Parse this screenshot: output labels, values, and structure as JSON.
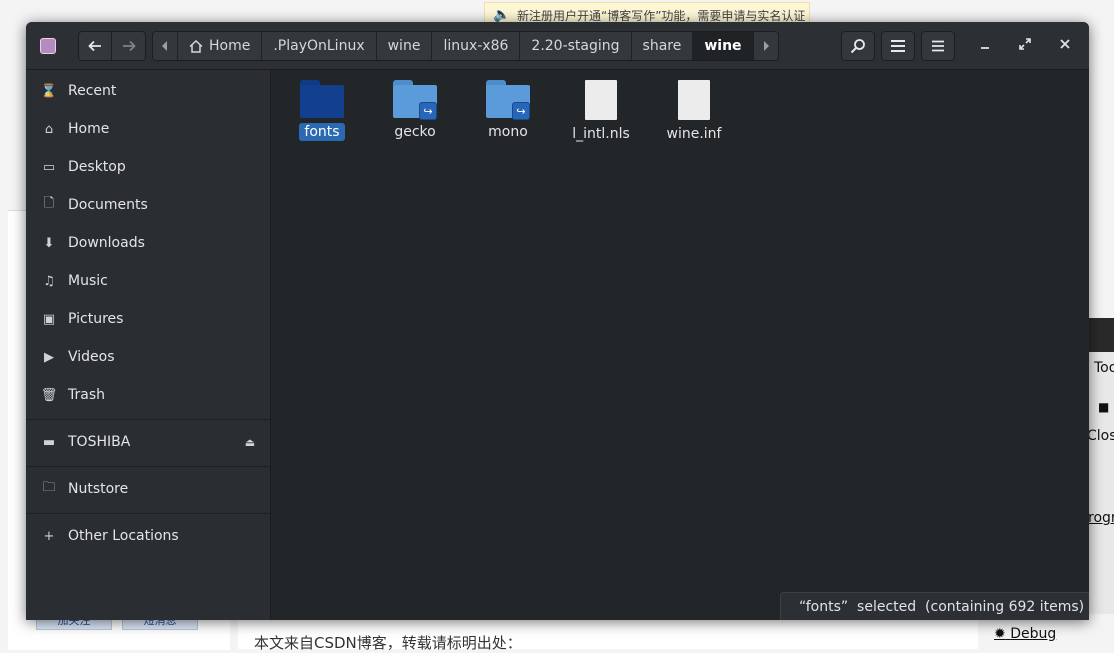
{
  "background": {
    "notice": "新注册用户开通“博客写作”功能，需要申请与实名认证",
    "buttons": [
      "加关注",
      "短消息"
    ],
    "article_text": "本文来自CSDN博客，转载请标明出处：",
    "right_window": {
      "tab": "Too",
      "close": "Clos",
      "link": "rogr",
      "debug": "Debug",
      "close2": "Close"
    }
  },
  "window": {
    "breadcrumbs": [
      ".PlayOnLinux",
      "wine",
      "linux-x86",
      "2.20-staging",
      "share",
      "wine"
    ],
    "home_label": "Home",
    "back_icon": "arrow-left-icon",
    "forward_icon": "arrow-right-icon"
  },
  "sidebar": {
    "items": [
      {
        "label": "Recent",
        "icon": "clock-icon"
      },
      {
        "label": "Home",
        "icon": "home-icon"
      },
      {
        "label": "Desktop",
        "icon": "desktop-icon"
      },
      {
        "label": "Documents",
        "icon": "document-icon"
      },
      {
        "label": "Downloads",
        "icon": "download-icon"
      },
      {
        "label": "Music",
        "icon": "music-icon"
      },
      {
        "label": "Pictures",
        "icon": "picture-icon"
      },
      {
        "label": "Videos",
        "icon": "video-icon"
      },
      {
        "label": "Trash",
        "icon": "trash-icon"
      }
    ],
    "devices": [
      {
        "label": "TOSHIBA",
        "icon": "drive-icon"
      }
    ],
    "network": [
      {
        "label": "Nutstore",
        "icon": "folder-icon"
      }
    ],
    "other": {
      "label": "Other Locations",
      "icon": "plus-icon"
    }
  },
  "files": [
    {
      "name": "fonts",
      "type": "folder",
      "selected": true
    },
    {
      "name": "gecko",
      "type": "folder-link",
      "selected": false
    },
    {
      "name": "mono",
      "type": "folder-link",
      "selected": false
    },
    {
      "name": "l_intl.nls",
      "type": "file",
      "selected": false
    },
    {
      "name": "wine.inf",
      "type": "file",
      "selected": false
    }
  ],
  "status": {
    "text": "“fonts”  selected  (containing 692 items)"
  },
  "colors": {
    "accent": "#2a6ab3",
    "folder": "#5b9bd9",
    "folder_selected": "#12408f"
  }
}
